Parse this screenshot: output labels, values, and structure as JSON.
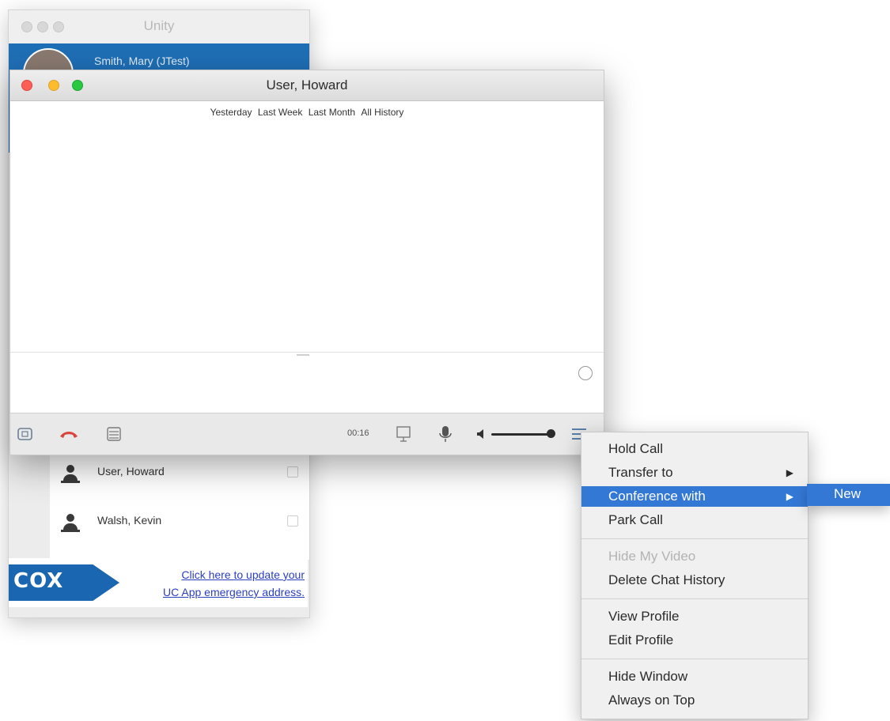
{
  "main_window": {
    "title": "Unity",
    "selected_contact": "Smith, Mary (JTest)",
    "contacts": [
      {
        "name": "User, Howard"
      },
      {
        "name": "Walsh, Kevin"
      }
    ],
    "banner": {
      "logo_text": "COX",
      "link_line1": "Click here to update your",
      "link_line2": "UC App emergency address."
    }
  },
  "chat_window": {
    "title": "User, Howard",
    "history_filters": [
      "Yesterday",
      "Last Week",
      "Last Month",
      "All History"
    ],
    "call_timer": "00:16",
    "icons": {
      "toolbar_left": [
        "video-toggle-icon",
        "hangup-icon",
        "dialpad-icon"
      ],
      "toolbar_right": [
        "screen-share-icon",
        "microphone-icon",
        "speaker-icon",
        "menu-icon"
      ]
    },
    "volume_level": 1.0
  },
  "context_menu": {
    "groups": [
      [
        {
          "label": "Hold Call",
          "enabled": true
        },
        {
          "label": "Transfer to",
          "enabled": true,
          "submenu": true
        },
        {
          "label": "Conference with",
          "enabled": true,
          "submenu": true,
          "highlighted": true
        },
        {
          "label": "Park Call",
          "enabled": true
        }
      ],
      [
        {
          "label": "Hide My Video",
          "enabled": false
        },
        {
          "label": "Delete Chat History",
          "enabled": true
        }
      ],
      [
        {
          "label": "View Profile",
          "enabled": true
        },
        {
          "label": "Edit Profile",
          "enabled": true
        }
      ],
      [
        {
          "label": "Hide Window",
          "enabled": true
        },
        {
          "label": "Always on Top",
          "enabled": true
        }
      ]
    ],
    "submenu_label": "New",
    "arrow_glyph": "▶"
  },
  "colors": {
    "selection_blue": "#1f6fb6",
    "menu_highlight": "#3478d6",
    "hangup_red": "#d9453c",
    "cox_blue": "#1a66b0",
    "link": "#2a3fbf"
  }
}
